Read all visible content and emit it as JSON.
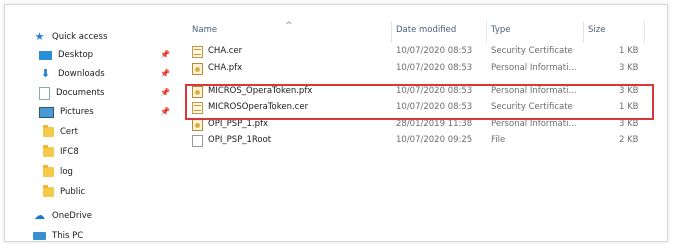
{
  "sidebar": {
    "items": [
      {
        "label": "Quick access",
        "icon": "star-icon",
        "pinned": false
      },
      {
        "label": "Desktop",
        "icon": "desktop-icon",
        "pinned": true
      },
      {
        "label": "Downloads",
        "icon": "download-arrow-icon",
        "pinned": true
      },
      {
        "label": "Documents",
        "icon": "documents-icon",
        "pinned": true
      },
      {
        "label": "Pictures",
        "icon": "pictures-icon",
        "pinned": true
      },
      {
        "label": "Cert",
        "icon": "folder-icon",
        "pinned": false
      },
      {
        "label": "IFC8",
        "icon": "folder-icon",
        "pinned": false
      },
      {
        "label": "log",
        "icon": "folder-icon",
        "pinned": false
      },
      {
        "label": "Public",
        "icon": "folder-icon",
        "pinned": false
      },
      {
        "label": "OneDrive",
        "icon": "cloud-icon",
        "pinned": false
      },
      {
        "label": "This PC",
        "icon": "computer-icon",
        "pinned": false
      }
    ],
    "pin_glyph": "📌"
  },
  "columns": {
    "name": "Name",
    "date": "Date modified",
    "type": "Type",
    "size": "Size",
    "sort_indicator": "^"
  },
  "files": [
    {
      "name": "CHA.cer",
      "date": "10/07/2020 08:53",
      "type": "Security Certificate",
      "size": "1 KB",
      "icon": "certificate-icon"
    },
    {
      "name": "CHA.pfx",
      "date": "10/07/2020 08:53",
      "type": "Personal Informati...",
      "size": "3 KB",
      "icon": "pfx-icon"
    },
    {
      "name": "MICROS_OperaToken.pfx",
      "date": "10/07/2020 08:53",
      "type": "Personal Informati...",
      "size": "3 KB",
      "icon": "pfx-icon"
    },
    {
      "name": "MICROSOperaToken.cer",
      "date": "10/07/2020 08:53",
      "type": "Security Certificate",
      "size": "1 KB",
      "icon": "certificate-icon"
    },
    {
      "name": "OPI_PSP_1.pfx",
      "date": "28/01/2019 11:38",
      "type": "Personal Informati...",
      "size": "3 KB",
      "icon": "pfx-icon"
    },
    {
      "name": "OPI_PSP_1Root",
      "date": "10/07/2020 09:25",
      "type": "File",
      "size": "2 KB",
      "icon": "file-icon"
    }
  ],
  "colors": {
    "highlight_border": "#d9383a",
    "header_text": "#4c607a",
    "folder": "#f5c94a",
    "accent": "#2a7fd4"
  }
}
